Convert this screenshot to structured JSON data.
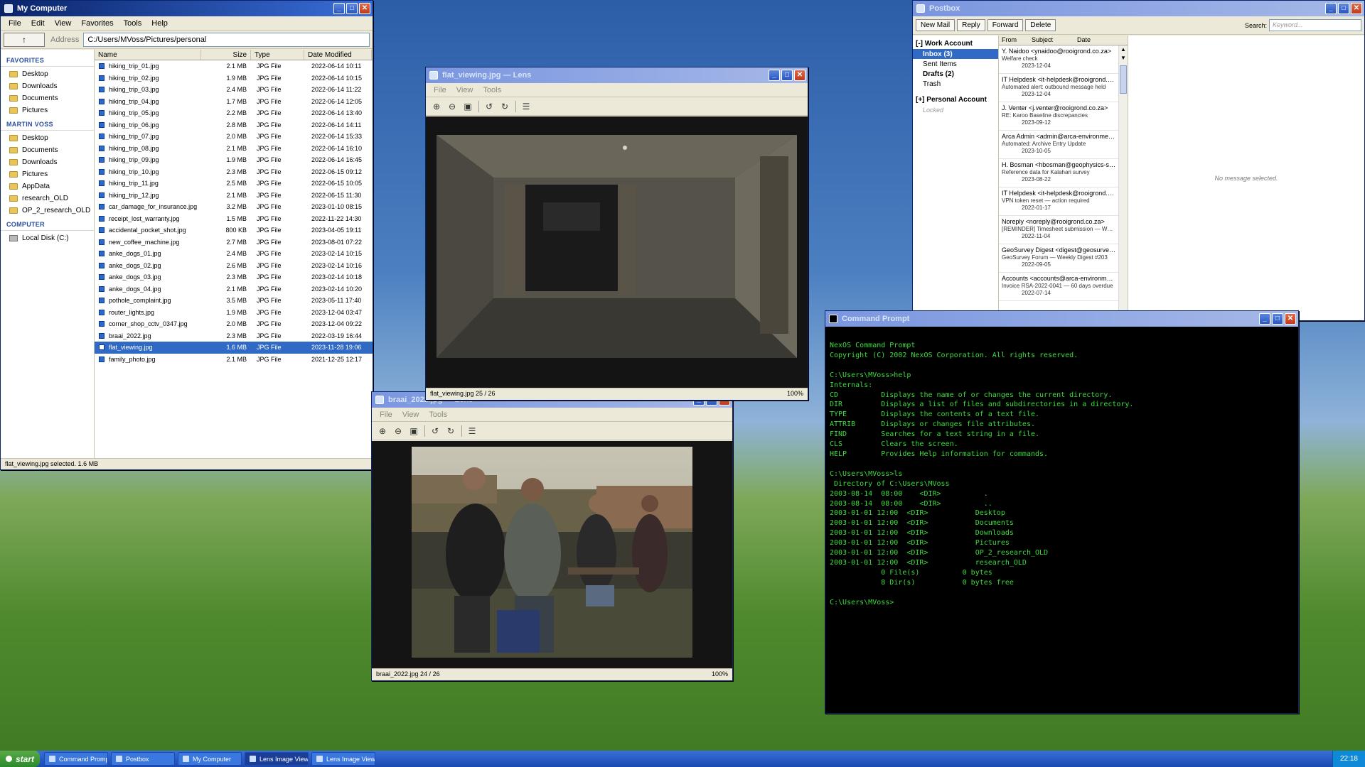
{
  "mycomputer": {
    "title": "My Computer",
    "menu": [
      "File",
      "Edit",
      "View",
      "Favorites",
      "Tools",
      "Help"
    ],
    "up_label": "↑",
    "address_label": "Address",
    "address": "C:/Users/MVoss/Pictures/personal",
    "nav": [
      {
        "head": "FAVORITES",
        "items": [
          "Desktop",
          "Downloads",
          "Documents",
          "Pictures"
        ]
      },
      {
        "head": "MARTIN VOSS",
        "items": [
          "Desktop",
          "Documents",
          "Downloads",
          "Pictures",
          "AppData",
          "research_OLD",
          "OP_2_research_OLD"
        ]
      },
      {
        "head": "COMPUTER",
        "items": [
          "Local Disk (C:)"
        ]
      }
    ],
    "columns": [
      "Name",
      "Size",
      "Type",
      "Date Modified"
    ],
    "files": [
      {
        "name": "hiking_trip_01.jpg",
        "size": "2.1 MB",
        "type": "JPG File",
        "date": "2022-06-14 10:11"
      },
      {
        "name": "hiking_trip_02.jpg",
        "size": "1.9 MB",
        "type": "JPG File",
        "date": "2022-06-14 10:15"
      },
      {
        "name": "hiking_trip_03.jpg",
        "size": "2.4 MB",
        "type": "JPG File",
        "date": "2022-06-14 11:22"
      },
      {
        "name": "hiking_trip_04.jpg",
        "size": "1.7 MB",
        "type": "JPG File",
        "date": "2022-06-14 12:05"
      },
      {
        "name": "hiking_trip_05.jpg",
        "size": "2.2 MB",
        "type": "JPG File",
        "date": "2022-06-14 13:40"
      },
      {
        "name": "hiking_trip_06.jpg",
        "size": "2.8 MB",
        "type": "JPG File",
        "date": "2022-06-14 14:11"
      },
      {
        "name": "hiking_trip_07.jpg",
        "size": "2.0 MB",
        "type": "JPG File",
        "date": "2022-06-14 15:33"
      },
      {
        "name": "hiking_trip_08.jpg",
        "size": "2.1 MB",
        "type": "JPG File",
        "date": "2022-06-14 16:10"
      },
      {
        "name": "hiking_trip_09.jpg",
        "size": "1.9 MB",
        "type": "JPG File",
        "date": "2022-06-14 16:45"
      },
      {
        "name": "hiking_trip_10.jpg",
        "size": "2.3 MB",
        "type": "JPG File",
        "date": "2022-06-15 09:12"
      },
      {
        "name": "hiking_trip_11.jpg",
        "size": "2.5 MB",
        "type": "JPG File",
        "date": "2022-06-15 10:05"
      },
      {
        "name": "hiking_trip_12.jpg",
        "size": "2.1 MB",
        "type": "JPG File",
        "date": "2022-06-15 11:30"
      },
      {
        "name": "car_damage_for_insurance.jpg",
        "size": "3.2 MB",
        "type": "JPG File",
        "date": "2023-01-10 08:15"
      },
      {
        "name": "receipt_lost_warranty.jpg",
        "size": "1.5 MB",
        "type": "JPG File",
        "date": "2022-11-22 14:30"
      },
      {
        "name": "accidental_pocket_shot.jpg",
        "size": "800 KB",
        "type": "JPG File",
        "date": "2023-04-05 19:11"
      },
      {
        "name": "new_coffee_machine.jpg",
        "size": "2.7 MB",
        "type": "JPG File",
        "date": "2023-08-01 07:22"
      },
      {
        "name": "anke_dogs_01.jpg",
        "size": "2.4 MB",
        "type": "JPG File",
        "date": "2023-02-14 10:15"
      },
      {
        "name": "anke_dogs_02.jpg",
        "size": "2.6 MB",
        "type": "JPG File",
        "date": "2023-02-14 10:16"
      },
      {
        "name": "anke_dogs_03.jpg",
        "size": "2.3 MB",
        "type": "JPG File",
        "date": "2023-02-14 10:18"
      },
      {
        "name": "anke_dogs_04.jpg",
        "size": "2.1 MB",
        "type": "JPG File",
        "date": "2023-02-14 10:20"
      },
      {
        "name": "pothole_complaint.jpg",
        "size": "3.5 MB",
        "type": "JPG File",
        "date": "2023-05-11 17:40"
      },
      {
        "name": "router_lights.jpg",
        "size": "1.9 MB",
        "type": "JPG File",
        "date": "2023-12-04 03:47"
      },
      {
        "name": "corner_shop_cctv_0347.jpg",
        "size": "2.0 MB",
        "type": "JPG File",
        "date": "2023-12-04 09:22"
      },
      {
        "name": "braai_2022.jpg",
        "size": "2.3 MB",
        "type": "JPG File",
        "date": "2022-03-19 16:44"
      },
      {
        "name": "flat_viewing.jpg",
        "size": "1.6 MB",
        "type": "JPG File",
        "date": "2023-11-28 19:06"
      },
      {
        "name": "family_photo.jpg",
        "size": "2.1 MB",
        "type": "JPG File",
        "date": "2021-12-25 12:17"
      }
    ],
    "selected_file": "flat_viewing.jpg",
    "status": "flat_viewing.jpg selected. 1.6 MB"
  },
  "lens1": {
    "title": "flat_viewing.jpg — Lens",
    "menu": [
      "File",
      "View",
      "Tools"
    ],
    "status": "flat_viewing.jpg 25 / 26",
    "zoom": "100%"
  },
  "lens2": {
    "title": "braai_2022.jpg — Lens",
    "menu": [
      "File",
      "View",
      "Tools"
    ],
    "status": "braai_2022.jpg 24 / 26",
    "zoom": "100%"
  },
  "postbox": {
    "title": "Postbox",
    "buttons": [
      "New Mail",
      "Reply",
      "Forward",
      "Delete"
    ],
    "search_label": "Search:",
    "search_placeholder": "Keyword...",
    "accounts": [
      {
        "label": "[-] Work Account",
        "folders": [
          {
            "name": "Inbox (3)",
            "state": "sel"
          },
          {
            "name": "Sent Items",
            "state": ""
          },
          {
            "name": "Drafts (2)",
            "state": "bold"
          },
          {
            "name": "Trash",
            "state": ""
          }
        ]
      },
      {
        "label": "[+] Personal Account",
        "folders": [
          {
            "name": "Locked",
            "state": "locked"
          }
        ]
      }
    ],
    "list_columns": [
      "From",
      "Subject",
      "Date"
    ],
    "messages": [
      {
        "from": "Y. Naidoo <ynaidoo@rooigrond.co.za>",
        "subject": "Welfare check",
        "date": "2023-12-04"
      },
      {
        "from": "IT Helpdesk <it-helpdesk@rooigrond.co.z...",
        "subject": "Automated alert: outbound message held",
        "date": "2023-12-04"
      },
      {
        "from": "J. Venter <j.venter@rooigrond.co.za>",
        "subject": "RE: Karoo Baseline discrepancies",
        "date": "2023-09-12"
      },
      {
        "from": "Arca Admin <admin@arca-environmental...",
        "subject": "Automated: Archive Entry Update",
        "date": "2023-10-05"
      },
      {
        "from": "H. Bosman <hbosman@geophysics-sa.co...",
        "subject": "Reference data for Kalahari survey",
        "date": "2023-08-22"
      },
      {
        "from": "IT Helpdesk <it-helpdesk@rooigrond.co.z...",
        "subject": "VPN token reset — action required",
        "date": "2022-01-17"
      },
      {
        "from": "Noreply <noreply@rooigrond.co.za>",
        "subject": "[REMINDER] Timesheet submission — Week 4...",
        "date": "2022-11-04"
      },
      {
        "from": "GeoSurvey Digest <digest@geosurvey-for...",
        "subject": "GeoSurvey Forum — Weekly Digest #203",
        "date": "2022-09-05"
      },
      {
        "from": "Accounts <accounts@arca-environmental...",
        "subject": "Invoice RSA-2022-0041 — 60 days overdue",
        "date": "2022-07-14"
      }
    ],
    "preview_text": "No message selected."
  },
  "cmd": {
    "title": "Command Prompt",
    "output": "NexOS Command Prompt\nCopyright (C) 2002 NexOS Corporation. All rights reserved.\n\nC:\\Users\\MVoss>help\nInternals:\nCD          Displays the name of or changes the current directory.\nDIR         Displays a list of files and subdirectories in a directory.\nTYPE        Displays the contents of a text file.\nATTRIB      Displays or changes file attributes.\nFIND        Searches for a text string in a file.\nCLS         Clears the screen.\nHELP        Provides Help information for commands.\n\nC:\\Users\\MVoss>ls\n Directory of C:\\Users\\MVoss\n2003-08-14  08:00    <DIR>          .\n2003-08-14  08:00    <DIR>          ..\n2003-01-01 12:00  <DIR>           Desktop\n2003-01-01 12:00  <DIR>           Documents\n2003-01-01 12:00  <DIR>           Downloads\n2003-01-01 12:00  <DIR>           Pictures\n2003-01-01 12:00  <DIR>           OP_2_research_OLD\n2003-01-01 12:00  <DIR>           research_OLD\n            0 File(s)          0 bytes\n            8 Dir(s)           0 bytes free\n\nC:\\Users\\MVoss>"
  },
  "taskbar": {
    "start": "start",
    "tasks": [
      {
        "label": "Command Prompt",
        "active": false
      },
      {
        "label": "Postbox",
        "active": false
      },
      {
        "label": "My Computer",
        "active": false
      },
      {
        "label": "Lens Image Viewer",
        "active": true
      },
      {
        "label": "Lens Image Viewer",
        "active": false
      }
    ],
    "clock": "22:18"
  }
}
